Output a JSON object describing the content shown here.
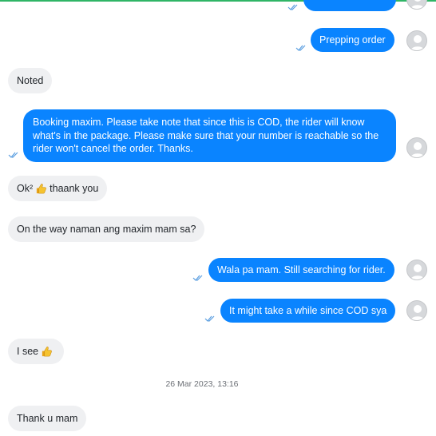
{
  "conversation": {
    "messages": [
      {
        "id": "m0",
        "side": "out",
        "text": "Prepping order",
        "partial": true
      },
      {
        "id": "m1",
        "side": "out",
        "text": "Prepping order"
      },
      {
        "id": "m2",
        "side": "in",
        "text": "Noted"
      },
      {
        "id": "m3",
        "side": "out",
        "text": "Booking maxim. Please take note that since this is COD, the rider will know what's in the package. Please make sure that your number is reachable so the rider won't cancel the order. Thanks."
      },
      {
        "id": "m4",
        "side": "in",
        "text_before": "Ok²",
        "emoji": "thumbs-up",
        "text_after": "thaank you"
      },
      {
        "id": "m5",
        "side": "in",
        "text": "On the way naman ang maxim mam sa?"
      },
      {
        "id": "m6",
        "side": "out",
        "text": "Wala pa mam. Still searching for rider."
      },
      {
        "id": "m7",
        "side": "out",
        "text": "It might take a while since COD sya"
      },
      {
        "id": "m8",
        "side": "in",
        "text_before": "I see",
        "emoji": "thumbs-up"
      },
      {
        "id": "m9",
        "side": "in",
        "text": "Thank u mam"
      }
    ],
    "timestamp": "26 Mar 2023, 13:16"
  },
  "colors": {
    "outgoing_bubble": "#0a84ff",
    "incoming_bubble": "#eff0f2",
    "top_accent": "#2fb566",
    "read_tick": "#5a9ee0"
  },
  "icons": {
    "read_receipt": "double-check-icon",
    "avatar": "default-user-avatar-icon",
    "emoji": "thumbs-up-icon"
  }
}
